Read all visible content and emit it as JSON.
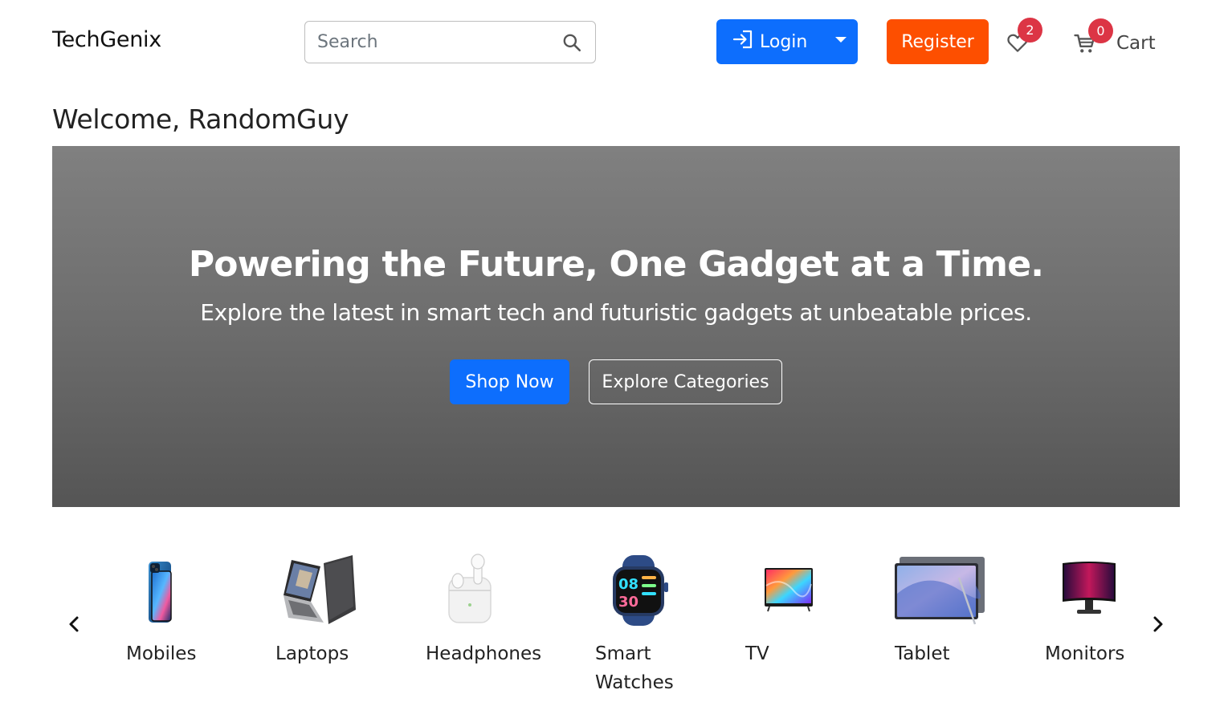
{
  "header": {
    "brand": "TechGenix",
    "search_placeholder": "Search",
    "login_label": "Login",
    "register_label": "Register",
    "wishlist_count": "2",
    "cart_count": "0",
    "cart_label": "Cart"
  },
  "welcome": "Welcome, RandomGuy",
  "hero": {
    "title": "Powering the Future, One Gadget at a Time.",
    "subtitle": "Explore the latest in smart tech and futuristic gadgets at unbeatable prices.",
    "shop_label": "Shop Now",
    "explore_label": "Explore Categories"
  },
  "categories": [
    {
      "label": "Mobiles",
      "icon": "mobile-phone-icon"
    },
    {
      "label": "Laptops",
      "icon": "laptop-icon"
    },
    {
      "label": "Headphones",
      "icon": "earbuds-icon"
    },
    {
      "label": "Smart",
      "label2": "Watches",
      "icon": "smartwatch-icon"
    },
    {
      "label": "TV",
      "icon": "tv-icon"
    },
    {
      "label": "Tablet",
      "icon": "tablet-icon"
    },
    {
      "label": "Monitors",
      "icon": "monitor-icon"
    }
  ],
  "colors": {
    "primary": "#0d6efd",
    "register": "#fd4f00",
    "badge": "#dc3545"
  }
}
